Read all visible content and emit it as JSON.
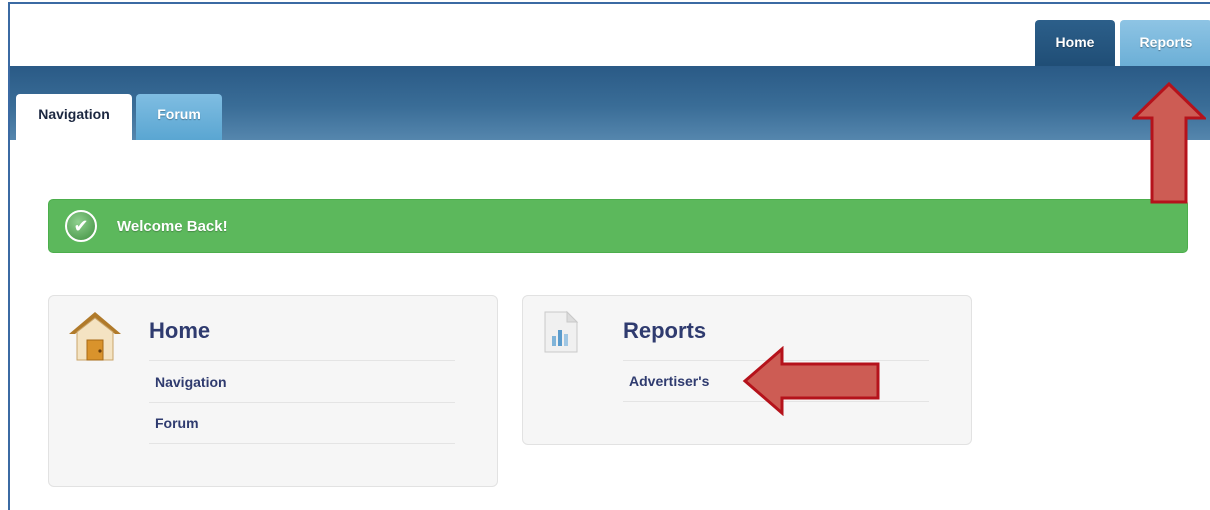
{
  "top_tabs": [
    {
      "label": "Home"
    },
    {
      "label": "Reports"
    }
  ],
  "sub_tabs": [
    {
      "label": "Navigation"
    },
    {
      "label": "Forum"
    }
  ],
  "alert": {
    "text": "Welcome Back!",
    "icon": "check-circle-icon"
  },
  "panels": {
    "home": {
      "title": "Home",
      "icon": "house-icon",
      "links": [
        {
          "label": "Navigation"
        },
        {
          "label": "Forum"
        }
      ]
    },
    "reports": {
      "title": "Reports",
      "icon": "report-chart-icon",
      "links": [
        {
          "label": "Advertiser's"
        }
      ]
    }
  },
  "colors": {
    "header_band": "#2a5a86",
    "alert_green": "#5cb85c",
    "panel_title": "#2f3b6f",
    "annotation_arrow": "#cd5c54",
    "annotation_outline": "#b5121b"
  }
}
